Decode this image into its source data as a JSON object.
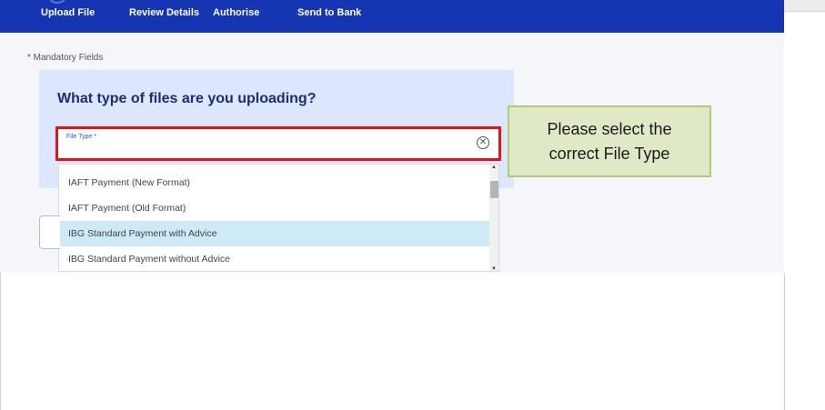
{
  "nav": {
    "steps": [
      "Upload File",
      "Review Details",
      "Authorise",
      "Send to Bank"
    ]
  },
  "form": {
    "mandatory_note": "* Mandatory Fields",
    "question": "What type of files are you uploading?",
    "file_type_label": "File Type *",
    "file_type_value": "",
    "options": [
      "IAFT Payment (New Format)",
      "IAFT Payment (Old Format)",
      "IBG Standard Payment with Advice",
      "IBG Standard Payment without Advice"
    ],
    "highlighted_option": "IBG Standard Payment with Advice"
  },
  "callout": {
    "line1": "Please select the",
    "line2": "correct File Type"
  },
  "colors": {
    "nav_bg": "#1535b3",
    "card_bg": "#dce6fc",
    "highlight_border": "#e01616",
    "option_highlight": "#cdeaf6",
    "callout_bg": "#dfe9c6"
  },
  "icons": {
    "clear": "circle-x",
    "scroll_up": "triangle-up",
    "scroll_down": "triangle-down"
  }
}
